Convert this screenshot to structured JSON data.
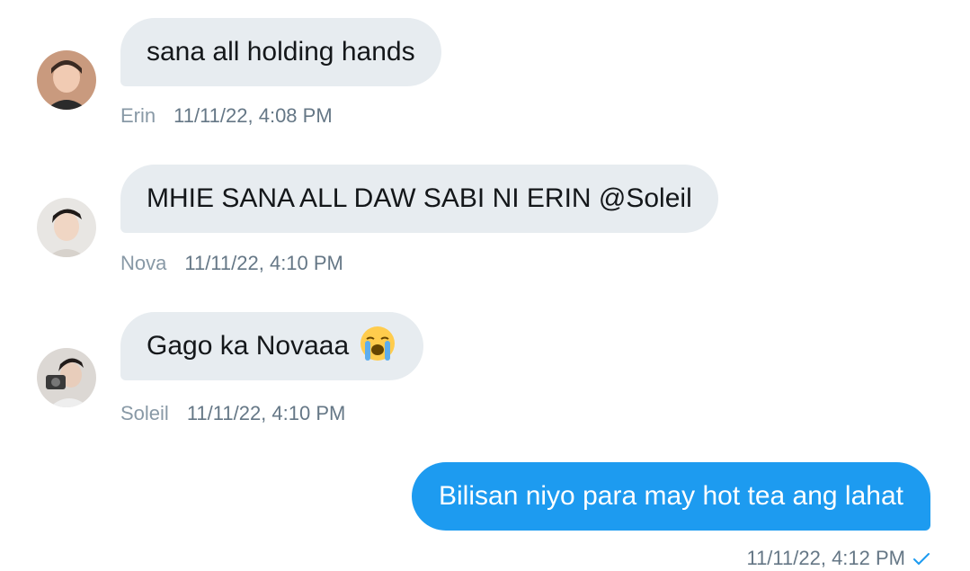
{
  "messages": [
    {
      "sender": "Erin",
      "text": "sana all holding hands",
      "time": "11/11/22, 4:08 PM"
    },
    {
      "sender": "Nova",
      "text": "MHIE SANA ALL DAW SABI NI ERIN @Soleil",
      "time": "11/11/22, 4:10 PM"
    },
    {
      "sender": "Soleil",
      "text": "Gago ka Novaaa",
      "emoji": "loudly-crying-face-icon",
      "time": "11/11/22, 4:10 PM"
    },
    {
      "sender": "me",
      "text": "Bilisan niyo para may hot tea ang lahat",
      "time": "11/11/22, 4:12 PM",
      "status_icon": "sent-check-icon"
    }
  ],
  "colors": {
    "incoming_bubble": "#e7ecf0",
    "outgoing_bubble": "#1d9bf0",
    "meta_text": "#657786",
    "check": "#1d9bf0"
  }
}
